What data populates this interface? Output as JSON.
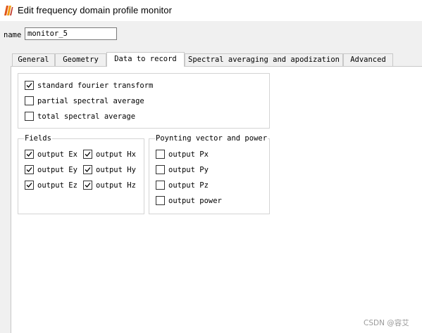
{
  "window": {
    "title": "Edit frequency domain profile monitor"
  },
  "name_field": {
    "label": "name",
    "value": "monitor_5"
  },
  "tabs": [
    {
      "label": "General"
    },
    {
      "label": "Geometry"
    },
    {
      "label": "Data to record",
      "active": true
    },
    {
      "label": "Spectral averaging and apodization"
    },
    {
      "label": "Advanced"
    }
  ],
  "averaging": {
    "items": [
      {
        "label": "standard fourier transform",
        "checked": true
      },
      {
        "label": "partial spectral average",
        "checked": false
      },
      {
        "label": "total spectral average",
        "checked": false
      }
    ]
  },
  "fields": {
    "title": "Fields",
    "items": [
      {
        "label": "output Ex",
        "checked": true
      },
      {
        "label": "output Hx",
        "checked": true
      },
      {
        "label": "output Ey",
        "checked": true
      },
      {
        "label": "output Hy",
        "checked": true
      },
      {
        "label": "output Ez",
        "checked": true
      },
      {
        "label": "output Hz",
        "checked": true
      }
    ]
  },
  "poynting": {
    "title": "Poynting vector and power",
    "items": [
      {
        "label": "output Px",
        "checked": false
      },
      {
        "label": "output Py",
        "checked": false
      },
      {
        "label": "output Pz",
        "checked": false
      },
      {
        "label": "output power",
        "checked": false
      }
    ]
  },
  "watermark": "CSDN @容艾"
}
